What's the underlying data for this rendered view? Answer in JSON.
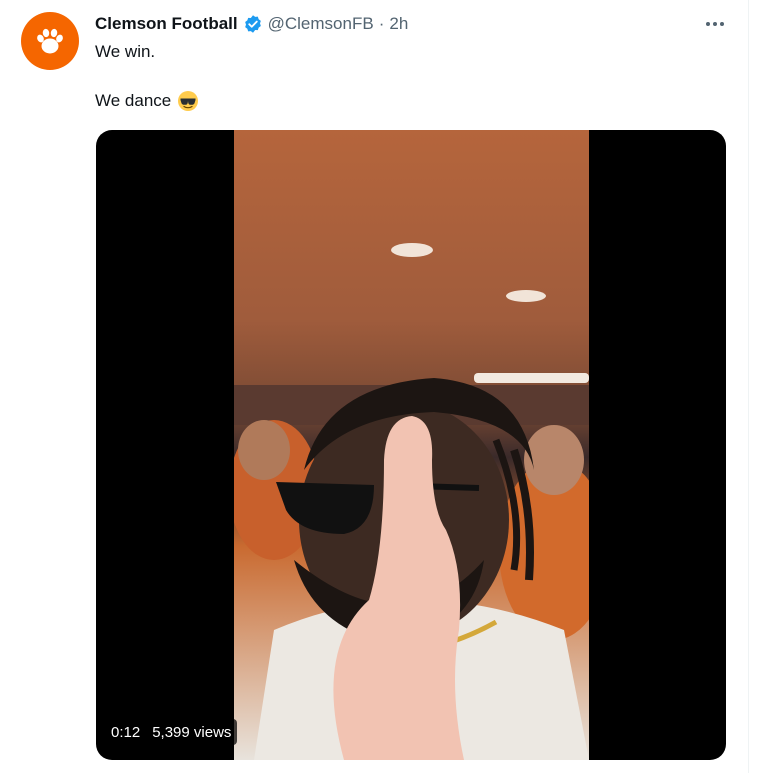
{
  "tweet": {
    "author_name": "Clemson Football",
    "handle": "@ClemsonFB",
    "separator": "·",
    "time": "2h",
    "text_line1": "We win.",
    "text_line2": "We dance",
    "emoji": "smiling-face-with-sunglasses",
    "more_icon": "more-horizontal-icon",
    "verified_icon": "verified-badge-icon"
  },
  "media": {
    "duration": "0:12",
    "views": "5,399 views"
  },
  "colors": {
    "brand_orange": "#f56600",
    "verified_blue": "#1d9bf0",
    "secondary_text": "#536471"
  }
}
